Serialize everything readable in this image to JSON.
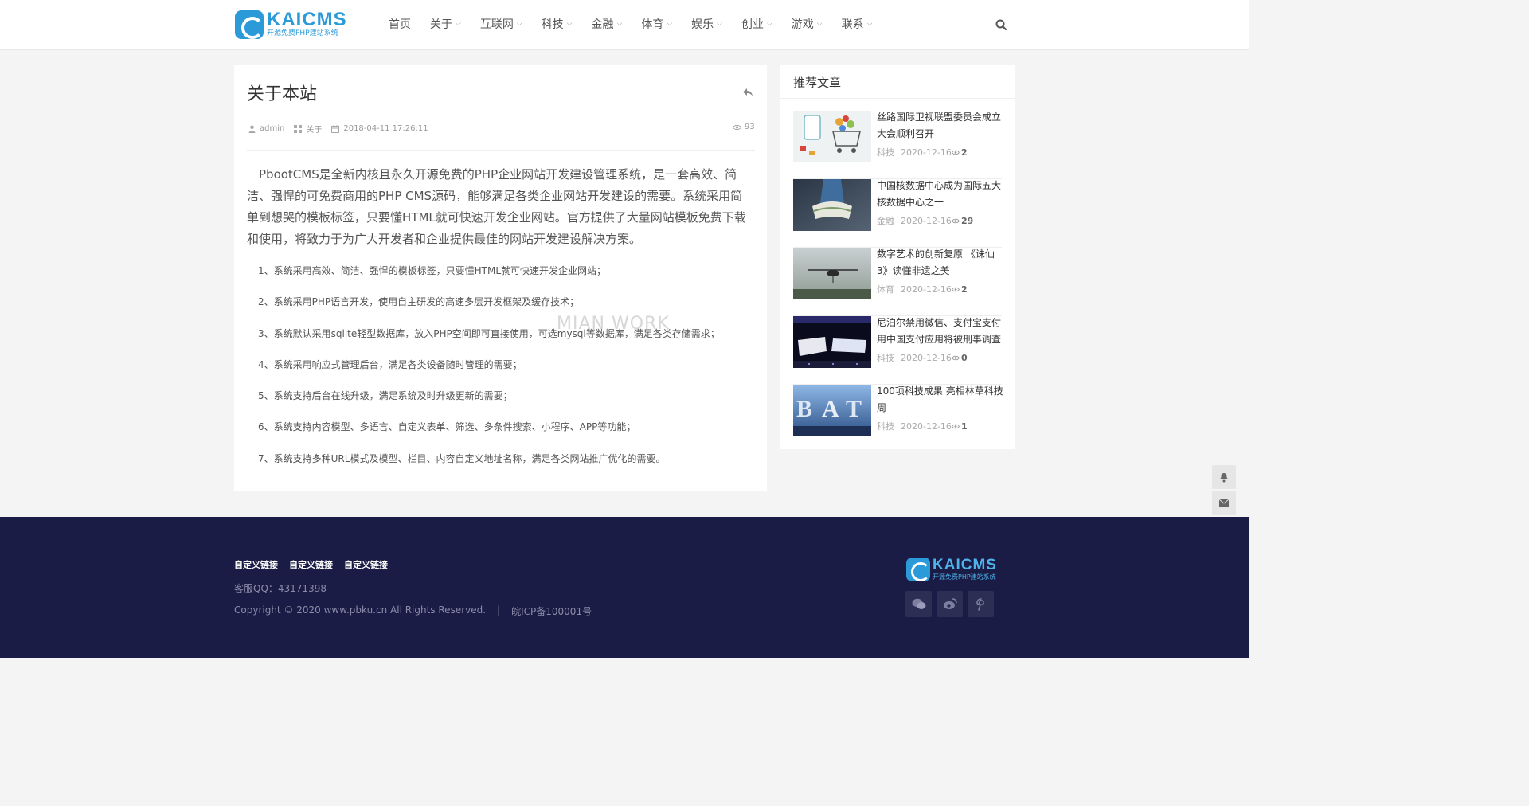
{
  "header": {
    "logo": {
      "title": "KAICMS",
      "subtitle": "开源免费PHP建站系统"
    },
    "nav": [
      {
        "label": "首页"
      },
      {
        "label": "关于"
      },
      {
        "label": "互联网"
      },
      {
        "label": "科技"
      },
      {
        "label": "金融"
      },
      {
        "label": "体育"
      },
      {
        "label": "娱乐"
      },
      {
        "label": "创业"
      },
      {
        "label": "游戏"
      },
      {
        "label": "联系"
      }
    ]
  },
  "article": {
    "title": "关于本站",
    "author": "admin",
    "category": "关于",
    "date": "2018-04-11 17:26:11",
    "views": "93",
    "intro": "PbootCMS是全新内核且永久开源免费的PHP企业网站开发建设管理系统，是一套高效、简洁、强悍的可免费商用的PHP CMS源码，能够满足各类企业网站开发建设的需要。系统采用简单到想哭的模板标签，只要懂HTML就可快速开发企业网站。官方提供了大量网站模板免费下载和使用，将致力于为广大开发者和企业提供最佳的网站开发建设解决方案。",
    "list": [
      "1、系统采用高效、简洁、强悍的模板标签，只要懂HTML就可快速开发企业网站；",
      "2、系统采用PHP语言开发，使用自主研发的高速多层开发框架及缓存技术；",
      "3、系统默认采用sqlite轻型数据库，放入PHP空间即可直接使用，可选mysql等数据库，满足各类存储需求；",
      "4、系统采用响应式管理后台，满足各类设备随时管理的需要；",
      "5、系统支持后台在线升级，满足系统及时升级更新的需要；",
      "6、系统支持内容模型、多语言、自定义表单、筛选、多条件搜索、小程序、APP等功能；",
      "7、系统支持多种URL模式及模型、栏目、内容自定义地址名称，满足各类网站推广优化的需要。"
    ],
    "watermark": "MIAN WORK"
  },
  "sidebar": {
    "title": "推荐文章",
    "items": [
      {
        "title": "丝路国际卫视联盟委员会成立大会顺利召开",
        "category": "科技",
        "date": "2020-12-16",
        "views": "2"
      },
      {
        "title": "中国核数据中心成为国际五大核数据中心之一",
        "category": "金融",
        "date": "2020-12-16",
        "views": "29"
      },
      {
        "title": "数字艺术的创新复原 《诛仙3》读懂非遗之美",
        "category": "体育",
        "date": "2020-12-16",
        "views": "2"
      },
      {
        "title": "尼泊尔禁用微信、支付宝支付用中国支付应用将被刑事调查",
        "category": "科技",
        "date": "2020-12-16",
        "views": "0"
      },
      {
        "title": "100项科技成果 亮相林草科技周",
        "category": "科技",
        "date": "2020-12-16",
        "views": "1"
      }
    ]
  },
  "footer": {
    "links": [
      "自定义链接",
      "自定义链接",
      "自定义链接"
    ],
    "qq": "客服QQ：43171398",
    "copyright": "Copyright © 2020 www.pbku.cn All Rights Reserved.",
    "separator": "|",
    "icp": "皖ICP备100001号",
    "logo": {
      "title": "KAICMS",
      "subtitle": "开源免费PHP建站系统"
    }
  },
  "colors": {
    "brand": "#2b9ad8",
    "footer_bg": "#1a1c45"
  },
  "icons": [
    "search-icon",
    "share-icon",
    "user-icon",
    "grid-icon",
    "calendar-icon",
    "eye-icon",
    "bell-icon",
    "mail-icon",
    "wechat-icon",
    "weibo-icon",
    "pinterest-icon"
  ]
}
